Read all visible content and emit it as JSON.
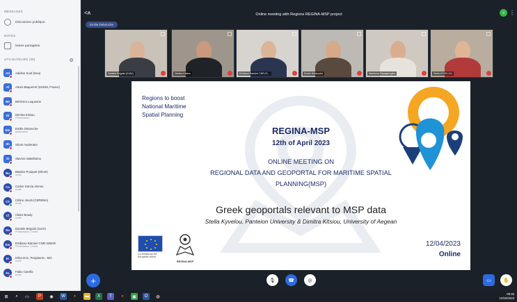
{
  "sidebar": {
    "messages_title": "MESSAGES",
    "public_chat": "Discussion publique",
    "notes_title": "NOTES",
    "shared_notes": "Notes partagées",
    "users_title": "UTILISATEURS (35)",
    "users": [
      {
        "initials": "Ad",
        "name": "Adeline Souf (Nou)",
        "status": "",
        "dot": "red"
      },
      {
        "initials": "Al",
        "name": "Alexis Baquerné (SHOM, France)",
        "status": "",
        "dot": "red"
      },
      {
        "initials": "Bé",
        "name": "Bérénice Lequesne",
        "status": "",
        "dot": "red"
      },
      {
        "initials": "Di",
        "name": "Dimitra Kitsiou",
        "status": "Présentateur",
        "dot": "red"
      },
      {
        "initials": "Em",
        "name": "Emilie Delaroche",
        "status": "Modérateur",
        "dot": "red"
      },
      {
        "initials": "Sh",
        "name": "Shom moderator",
        "status": "",
        "dot": "red"
      },
      {
        "initials": "St",
        "name": "Stavros Sakellariou",
        "status": "",
        "dot": "red"
      },
      {
        "initials": "Ba",
        "name": "Bastien Pouquet (Shom)",
        "status": "Invité",
        "dot": "red"
      },
      {
        "initials": "Ca",
        "name": "Carlos Garcia Alonso",
        "status": "Invité",
        "dot": "red"
      },
      {
        "initials": "Cé",
        "name": "Céline Jacob (CEREMA)",
        "status": "Invité",
        "dot": "green"
      },
      {
        "initials": "Cl",
        "name": "Claire Boudy",
        "status": "Invité",
        "dot": "red"
      },
      {
        "initials": "Da",
        "name": "Daniele Brigolin (IUAV)",
        "status": "Présentateur | Invité",
        "dot": "red"
      },
      {
        "initials": "Em",
        "name": "Emiliano Ramieri CNR-ISMAR",
        "status": "Présentateur | Invité",
        "dot": "red"
      },
      {
        "initials": "Er",
        "name": "Erika M.G. Pergiannis - MO",
        "status": "Invité",
        "dot": "red"
      },
      {
        "initials": "Fa",
        "name": "Fabio Carella",
        "status": "Invité",
        "dot": "red"
      }
    ]
  },
  "meeting": {
    "title": "Online meeting with Regions REGINA-MSP project",
    "role_pill": "Emilie Delaroche",
    "webcams": [
      {
        "label": "Daniele Brigolin (IUAV)"
      },
      {
        "label": "Dimitra Kitsiou"
      },
      {
        "label": "Emiliano Ramieri CNR-IS..."
      },
      {
        "label": "Emilie Delaroche"
      },
      {
        "label": "Marianna Papageorgiou"
      },
      {
        "label": "Stella KYVELOU"
      }
    ]
  },
  "slide": {
    "top_line1": "Regions to boost",
    "top_line2": "National Maritime",
    "top_line3": "Spatial Planning",
    "project": "REGINA-MSP",
    "date_big": "12th of April 2023",
    "meeting_l1": "ONLINE MEETING ON",
    "meeting_l2": "REGIONAL DATA AND GEOPORTAL FOR MARITIME SPATIAL",
    "meeting_l3": "PLANNING(MSP)",
    "talk_title": "Greek geoportals relevant to MSP data",
    "authors": "Stella Kyvelou, Panteion University & Dimitra Kitsiou, University of Aegean",
    "date_small": "12/04/2023",
    "mode": "Online",
    "eu_text": "Co-funded by the European Union",
    "regina_logo_text": "REGINA-MSP"
  },
  "taskbar": {
    "time": "09:45",
    "date": "12/04/2023"
  },
  "colors": {
    "brand_blue": "#2d6ae0",
    "slide_navy": "#1b2a6b",
    "orange_pin": "#f5a623",
    "blue_pin": "#1f93d6"
  }
}
